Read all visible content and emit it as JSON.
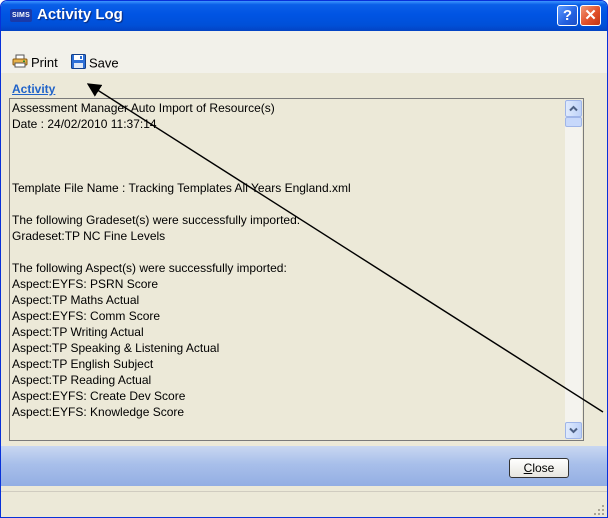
{
  "window": {
    "app_logo": "SIMS",
    "title": "Activity Log",
    "help_glyph": "?",
    "close_glyph": "✕"
  },
  "toolbar": {
    "print_label": "Print",
    "save_label": "Save"
  },
  "section": {
    "label": "Activity"
  },
  "log": {
    "lines": [
      "Assessment Manager Auto Import of Resource(s)",
      "Date : 24/02/2010 11:37:14",
      "",
      "",
      "",
      "Template File Name : Tracking Templates All Years England.xml",
      "",
      "The following Gradeset(s) were successfully imported:",
      "Gradeset:TP NC Fine Levels",
      "",
      "The following Aspect(s) were successfully imported:",
      "Aspect:EYFS: PSRN Score",
      "Aspect:TP Maths Actual",
      "Aspect:EYFS: Comm Score",
      "Aspect:TP Writing Actual",
      "Aspect:TP Speaking & Listening Actual",
      "Aspect:TP English Subject",
      "Aspect:TP Reading Actual",
      "Aspect:EYFS: Create Dev Score",
      "Aspect:EYFS: Knowledge Score"
    ]
  },
  "footer": {
    "close_label": "Close"
  },
  "colors": {
    "title_bar": "#0054e3",
    "section_label": "#2063c9",
    "content_background": "#ece9d8",
    "footer_band": "#a8bfea"
  },
  "icons": [
    "printer-icon",
    "floppy-disk-icon",
    "help-icon",
    "close-icon"
  ]
}
